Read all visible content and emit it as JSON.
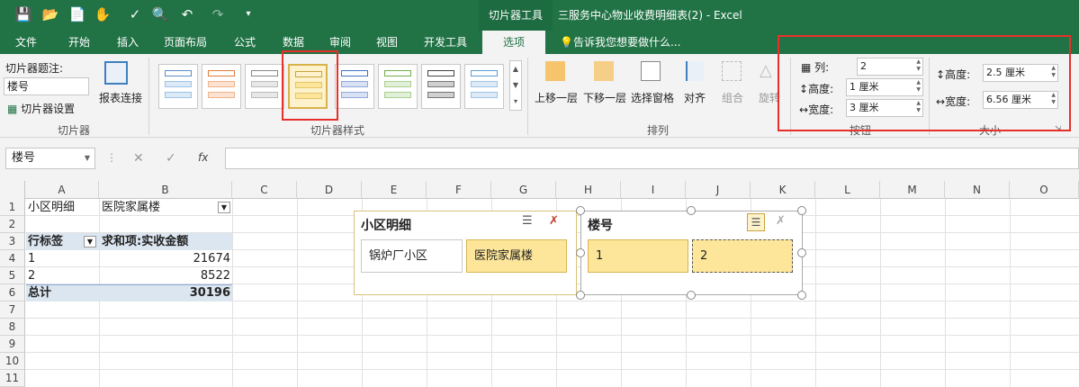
{
  "quick_access": {
    "save_icon": "save-icon",
    "open_icon": "open-folder-icon",
    "new_icon": "new-document-icon",
    "touch_icon": "touch-mode-icon",
    "spell_icon": "spelling-icon",
    "preview_icon": "print-preview-icon",
    "undo_icon": "undo-icon",
    "redo_icon": "redo-icon",
    "customize_icon": "customize-icon"
  },
  "window": {
    "context_tool": "切片器工具",
    "title": "三服务中心物业收费明细表(2) - Excel"
  },
  "tabs": [
    "文件",
    "开始",
    "插入",
    "页面布局",
    "公式",
    "数据",
    "审阅",
    "视图",
    "开发工具",
    "选项"
  ],
  "tell_me": "告诉我您想要做什么...",
  "ribbon": {
    "slicer_caption_label": "切片器题注:",
    "slicer_caption_value": "楼号",
    "slicer_settings": "切片器设置",
    "report_connections": "报表连接",
    "group_slicer": "切片器",
    "group_styles": "切片器样式",
    "bring_forward": "上移一层",
    "send_backward": "下移一层",
    "selection_pane": "选择窗格",
    "align": "对齐",
    "group": "组合",
    "rotate": "旋转",
    "group_arrange": "排列",
    "columns_label": "列:",
    "columns_value": "2",
    "btn_height_label": "高度:",
    "btn_height_value": "1 厘米",
    "btn_width_label": "宽度:",
    "btn_width_value": "3 厘米",
    "group_buttons": "按钮",
    "size_height_label": "高度:",
    "size_height_value": "2.5 厘米",
    "size_width_label": "宽度:",
    "size_width_value": "6.56 厘米",
    "group_size": "大小"
  },
  "formula_bar": {
    "name_box": "楼号",
    "fx": "fx",
    "formula": ""
  },
  "columns": [
    "A",
    "B",
    "C",
    "D",
    "E",
    "F",
    "G",
    "H",
    "I",
    "J",
    "K",
    "L",
    "M",
    "N",
    "O"
  ],
  "rows": [
    "1",
    "2",
    "3",
    "4",
    "5",
    "6",
    "7",
    "8",
    "9",
    "10",
    "11"
  ],
  "sheet": {
    "a1": "小区明细",
    "b1": "医院家属楼",
    "a3": "行标签",
    "b3": "求和项:实收金额",
    "a4": "1",
    "b4": "21674",
    "a5": "2",
    "b5": "8522",
    "a6": "总计",
    "b6": "30196"
  },
  "slicer1": {
    "title": "小区明细",
    "items": [
      "锅炉厂小区",
      "医院家属楼"
    ]
  },
  "slicer2": {
    "title": "楼号",
    "items": [
      "1",
      "2"
    ]
  },
  "colors": {
    "excel_green": "#217346",
    "highlight_red": "#e8302a",
    "slicer_selected": "#fde69a",
    "pivot_header": "#dce6f1"
  }
}
